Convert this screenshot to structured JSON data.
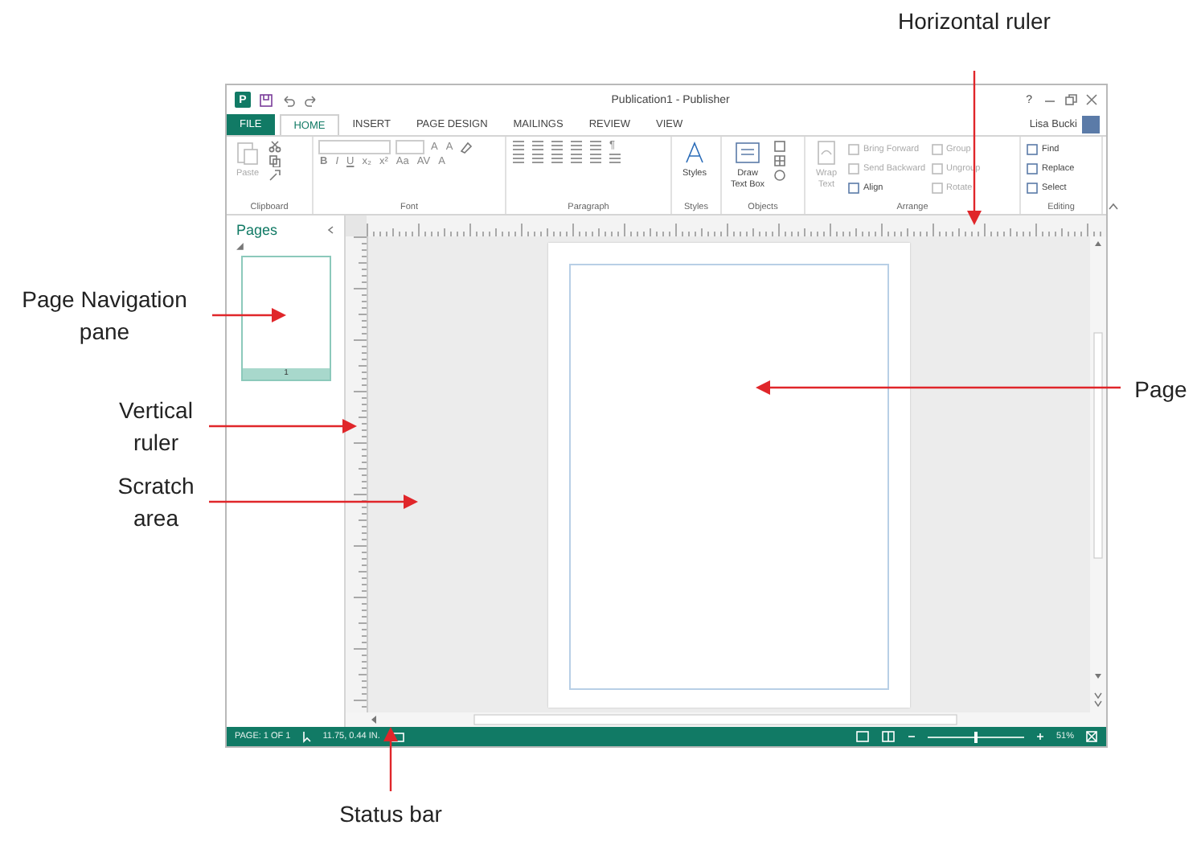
{
  "window": {
    "logo_letter": "P",
    "title": "Publication1 - Publisher",
    "help": "?",
    "user": "Lisa Bucki"
  },
  "tabs": [
    {
      "label": "FILE",
      "kind": "file",
      "selected": false
    },
    {
      "label": "HOME",
      "kind": "tab",
      "selected": true
    },
    {
      "label": "INSERT",
      "kind": "tab",
      "selected": false
    },
    {
      "label": "PAGE DESIGN",
      "kind": "tab",
      "selected": false
    },
    {
      "label": "MAILINGS",
      "kind": "tab",
      "selected": false
    },
    {
      "label": "REVIEW",
      "kind": "tab",
      "selected": false
    },
    {
      "label": "VIEW",
      "kind": "tab",
      "selected": false
    }
  ],
  "ribbon": {
    "groups": [
      {
        "kind": "clipboard",
        "label": "Clipboard",
        "commands": [
          {
            "label": "Paste",
            "disabled": true
          }
        ]
      },
      {
        "kind": "font",
        "label": "Font",
        "top": [
          "A",
          "A"
        ],
        "buttons": [
          "B",
          "I",
          "U",
          "x₂",
          "x²",
          "Aa",
          "AV",
          "A"
        ]
      },
      {
        "kind": "paragraph",
        "label": "Paragraph",
        "pilcrow": "¶"
      },
      {
        "kind": "styles",
        "label": "Styles",
        "commands": [
          {
            "label": "Styles",
            "disabled": false
          }
        ]
      },
      {
        "kind": "objects",
        "label": "Objects",
        "commands": [
          {
            "label": "Draw Text Box",
            "disabled": false
          }
        ]
      },
      {
        "kind": "arrange",
        "label": "Arrange",
        "commands": [
          {
            "label": "Wrap Text",
            "disabled": true
          },
          {
            "label": "Bring Forward",
            "disabled": true
          },
          {
            "label": "Send Backward",
            "disabled": true
          },
          {
            "label": "Align",
            "disabled": false
          },
          {
            "label": "Group",
            "disabled": true
          },
          {
            "label": "Ungroup",
            "disabled": true
          },
          {
            "label": "Rotate",
            "disabled": true
          }
        ]
      },
      {
        "kind": "editing",
        "label": "Editing",
        "commands": [
          {
            "label": "Find",
            "disabled": false
          },
          {
            "label": "Replace",
            "disabled": false
          },
          {
            "label": "Select",
            "disabled": false
          }
        ]
      }
    ]
  },
  "pages_pane": {
    "title": "Pages",
    "pages": [
      {
        "number": "1",
        "selected": true
      }
    ]
  },
  "status_bar": {
    "page": "PAGE: 1 OF 1",
    "position": "11.75, 0.44 IN.",
    "zoom": {
      "level": 0.5,
      "reading": "51%"
    }
  },
  "callouts": [
    {
      "label": "Horizontal ruler"
    },
    {
      "label": "Page Navigation pane"
    },
    {
      "label": "Vertical ruler"
    },
    {
      "label": "Scratch area"
    },
    {
      "label": "Page"
    },
    {
      "label": "Status bar"
    }
  ]
}
